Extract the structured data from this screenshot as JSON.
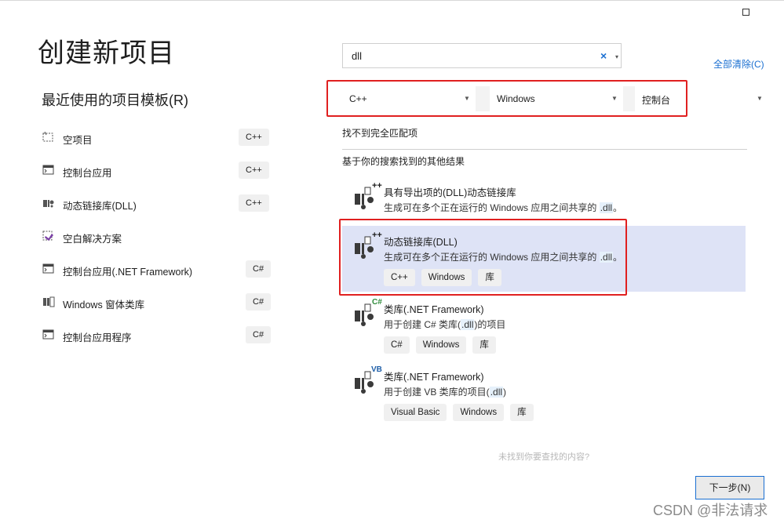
{
  "page": {
    "title": "创建新项目"
  },
  "recent": {
    "heading": "最近使用的项目模板(R)",
    "items": [
      {
        "label": "空项目",
        "badge": "C++",
        "icon": "empty-project-icon"
      },
      {
        "label": "控制台应用",
        "badge": "C++",
        "icon": "console-app-icon"
      },
      {
        "label": "动态链接库(DLL)",
        "badge": "C++",
        "icon": "dll-icon"
      },
      {
        "label": "空白解决方案",
        "badge": "",
        "icon": "blank-solution-icon"
      },
      {
        "label": "控制台应用(.NET Framework)",
        "badge": "C#",
        "icon": "console-app-icon"
      },
      {
        "label": "Windows 窗体类库",
        "badge": "C#",
        "icon": "class-library-icon"
      },
      {
        "label": "控制台应用程序",
        "badge": "C#",
        "icon": "console-app-icon"
      }
    ]
  },
  "search": {
    "value": "dll",
    "clear_icon": "×",
    "dropdown_icon": "▾"
  },
  "clear_all": "全部清除(C)",
  "filters": {
    "language": "C++",
    "platform": "Windows",
    "project_type": "控制台"
  },
  "no_exact_match": "找不到完全匹配项",
  "other_results": "基于你的搜索找到的其他结果",
  "results": [
    {
      "name": "具有导出项的(DLL)动态链接库",
      "desc_pre": "生成可在多个正在运行的 Windows 应用之间共享的 ",
      "desc_hl": ".dll",
      "desc_post": "。",
      "tags": [],
      "lang_badge": "++",
      "lang_color": "#7a3fa6"
    },
    {
      "name": "动态链接库(DLL)",
      "desc_pre": "生成可在多个正在运行的 Windows 应用之间共享的 ",
      "desc_hl": ".dll",
      "desc_post": "。",
      "tags": [
        "C++",
        "Windows",
        "库"
      ],
      "lang_badge": "++",
      "lang_color": "#7a3fa6"
    },
    {
      "name": "类库(.NET Framework)",
      "desc_pre": "用于创建 C# 类库(",
      "desc_hl": ".dll",
      "desc_post": ")的项目",
      "tags": [
        "C#",
        "Windows",
        "库"
      ],
      "lang_badge": "C#",
      "lang_color": "#2e8b3a"
    },
    {
      "name": "类库(.NET Framework)",
      "desc_pre": "用于创建 VB 类库的项目(",
      "desc_hl": ".dll",
      "desc_post": ")",
      "tags": [
        "Visual Basic",
        "Windows",
        "库"
      ],
      "lang_badge": "VB",
      "lang_color": "#1f5fa8"
    }
  ],
  "not_found_hint": "未找到你要查找的内容?",
  "next_button": "下一步(N)",
  "watermark": "CSDN @非法请求",
  "colors": {
    "accent": "#1a6fd1",
    "highlight_box": "#e02020",
    "selected_row": "#dee3f6"
  }
}
